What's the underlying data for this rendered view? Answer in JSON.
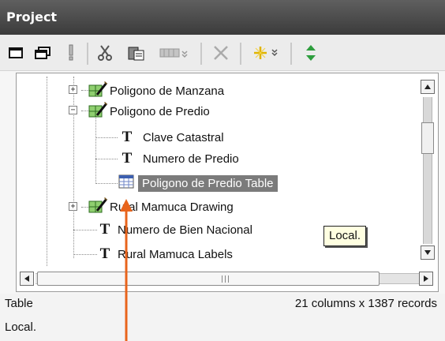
{
  "panel": {
    "title": "Project"
  },
  "toolbar": {
    "icons": [
      "window-icon",
      "restore-window-icon",
      "properties-icon",
      "cut-icon",
      "paste-icon",
      "import-icon",
      "delete-icon",
      "new-item-icon",
      "refresh-icon"
    ]
  },
  "tree": {
    "nodes": [
      {
        "label": "Poligono de Manzana",
        "kind": "drawing",
        "expander": "+"
      },
      {
        "label": "Poligono de Predio",
        "kind": "drawing",
        "expander": "−"
      },
      {
        "label": "Clave Catastral",
        "kind": "label"
      },
      {
        "label": "Numero de Predio",
        "kind": "label"
      },
      {
        "label": "Poligono de Predio Table",
        "kind": "table",
        "selected": true
      },
      {
        "label": "Rural Mamuca Drawing",
        "kind": "drawing",
        "expander": "+"
      },
      {
        "label": "Numero de Bien Nacional",
        "kind": "label"
      },
      {
        "label": "Rural Mamuca Labels",
        "kind": "label"
      }
    ]
  },
  "tooltip": {
    "text": "Local."
  },
  "status": {
    "type": "Table",
    "summary": "21 columns x 1387 records",
    "tip": "Local."
  },
  "colors": {
    "titlebar": "#4a4a4a",
    "selection": "#7b7b7b",
    "arrow": "#e8641c"
  }
}
